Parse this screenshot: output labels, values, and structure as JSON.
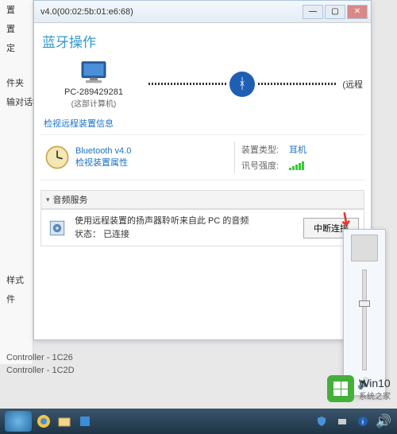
{
  "window": {
    "title": "v4.0(00:02:5b:01:e6:68)",
    "page_heading": "蓝牙操作"
  },
  "sidebar": {
    "items": [
      "置",
      "置",
      "定",
      "件夹",
      "输对话框",
      "样式",
      "件"
    ]
  },
  "pc": {
    "name": "PC-289429281",
    "subtitle": "(这部计算机)"
  },
  "remote_suffix": "(远程",
  "links": {
    "view_remote_info": "检视远程装置信息",
    "view_props": "检视装置属性"
  },
  "bluetooth": {
    "version": "Bluetooth v4.0"
  },
  "specs": {
    "type_label": "装置类型:",
    "type_value": "耳机",
    "signal_label": "讯号强度:"
  },
  "audio_section": {
    "header": "音频服务",
    "line1": "使用远程装置的扬声器聆听来自此 PC 的音频",
    "line2_label": "状态：",
    "line2_value": "已连接",
    "button": "中断连接"
  },
  "controllers": {
    "c1": "Controller - 1C26",
    "c2": "Controller - 1C2D"
  },
  "watermark": {
    "brand": "Win10",
    "site": "系统之家"
  }
}
